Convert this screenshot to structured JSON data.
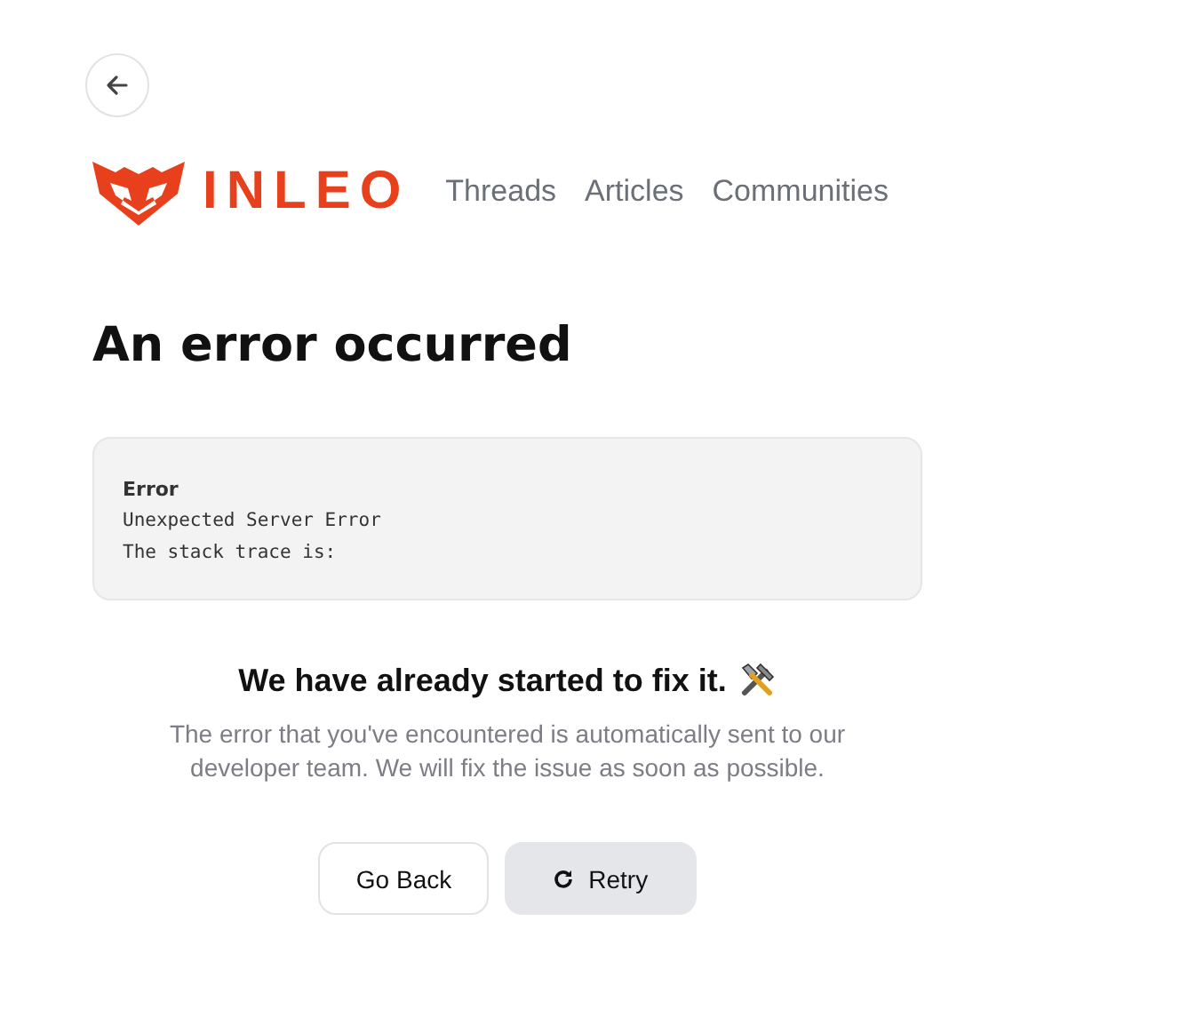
{
  "header": {
    "logo": "INLEO",
    "nav": [
      {
        "label": "Threads"
      },
      {
        "label": "Articles"
      },
      {
        "label": "Communities"
      }
    ]
  },
  "title": "An error occurred",
  "error_box": {
    "label": "Error",
    "lines": [
      "Unexpected Server Error",
      "The stack trace is:"
    ]
  },
  "message": {
    "heading": "We have already started to fix it.",
    "body": "The error that you've encountered is automatically sent to our developer team. We will fix the issue as soon as possible."
  },
  "buttons": [
    {
      "label": "Go Back",
      "kind": "outline"
    },
    {
      "label": "Retry",
      "kind": "retry"
    }
  ]
}
